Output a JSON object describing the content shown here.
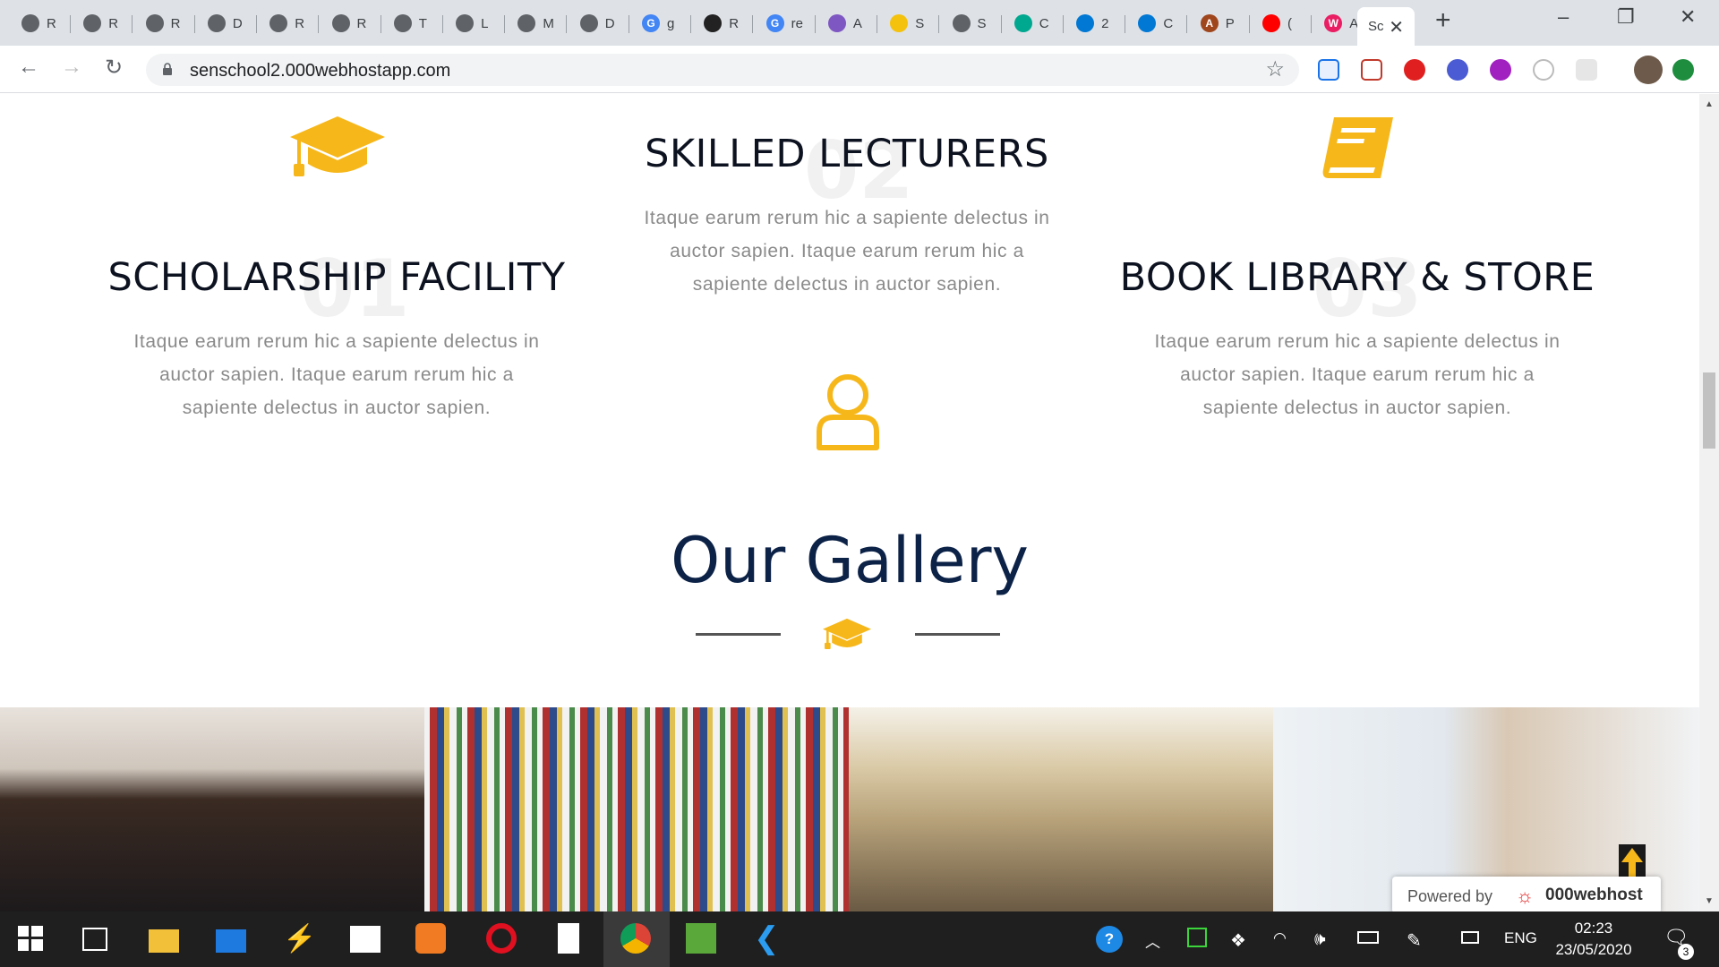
{
  "browser": {
    "tabs": [
      {
        "letter": "R",
        "fav": "globe",
        "color": "#5f6368"
      },
      {
        "letter": "R",
        "fav": "globe",
        "color": "#5f6368"
      },
      {
        "letter": "R",
        "fav": "globe",
        "color": "#5f6368"
      },
      {
        "letter": "D",
        "fav": "globe",
        "color": "#5f6368"
      },
      {
        "letter": "R",
        "fav": "globe",
        "color": "#5f6368"
      },
      {
        "letter": "R",
        "fav": "globe",
        "color": "#5f6368"
      },
      {
        "letter": "T",
        "fav": "globe",
        "color": "#5f6368"
      },
      {
        "letter": "L",
        "fav": "globe",
        "color": "#5f6368"
      },
      {
        "letter": "M",
        "fav": "globe",
        "color": "#5f6368"
      },
      {
        "letter": "D",
        "fav": "globe",
        "color": "#5f6368"
      },
      {
        "letter": "g",
        "fav": "G",
        "color": "#4285f4"
      },
      {
        "letter": "R",
        "fav": "codepen",
        "color": "#222222"
      },
      {
        "letter": "re",
        "fav": "G",
        "color": "#4285f4"
      },
      {
        "letter": "A",
        "fav": "apollo",
        "color": "#7e57c2"
      },
      {
        "letter": "S",
        "fav": "heart",
        "color": "#f4c20d"
      },
      {
        "letter": "S",
        "fav": "globe",
        "color": "#5f6368"
      },
      {
        "letter": "C",
        "fav": "diamond",
        "color": "#00a88f"
      },
      {
        "letter": "2",
        "fav": "azure",
        "color": "#0078d4"
      },
      {
        "letter": "C",
        "fav": "azure",
        "color": "#0078d4"
      },
      {
        "letter": "P",
        "fav": "A",
        "color": "#a0461d"
      },
      {
        "letter": "(",
        "fav": "youtube",
        "color": "#ff0000"
      },
      {
        "letter": "A",
        "fav": "W",
        "color": "#e91e63"
      }
    ],
    "active_tab": {
      "title": "Sc"
    },
    "url": "senschool2.000webhostapp.com"
  },
  "features": [
    {
      "num": "01",
      "title": "SCHOLARSHIP FACILITY",
      "desc": [
        "Itaque earum rerum hic a sapiente delectus in",
        "auctor sapien. Itaque earum rerum hic a",
        "sapiente delectus in auctor sapien."
      ],
      "icon": "graduation-cap-icon"
    },
    {
      "num": "02",
      "title": "SKILLED LECTURERS",
      "desc": [
        "Itaque earum rerum hic a sapiente delectus in",
        "auctor sapien. Itaque earum rerum hic a",
        "sapiente delectus in auctor sapien."
      ],
      "icon": "user-icon"
    },
    {
      "num": "03",
      "title": "BOOK LIBRARY & STORE",
      "desc": [
        "Itaque earum rerum hic a sapiente delectus in",
        "auctor sapien. Itaque earum rerum hic a",
        "sapiente delectus in auctor sapien."
      ],
      "icon": "book-icon"
    }
  ],
  "gallery": {
    "title": "Our Gallery",
    "photos": [
      "students-group-photo",
      "library-bookshelves-photo",
      "classroom-students-photo",
      "graduate-speaking-photo"
    ]
  },
  "badge": {
    "powered_by": "Powered by",
    "brand": "000webhost"
  },
  "accent_color": "#f6b71a",
  "taskbar": {
    "language": "ENG",
    "time": "02:23",
    "date": "23/05/2020",
    "notifications": "3"
  }
}
